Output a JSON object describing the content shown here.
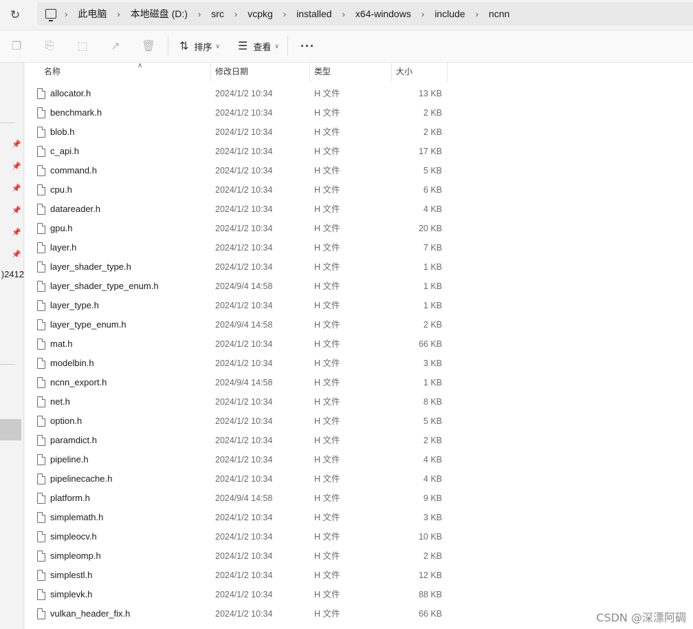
{
  "address_bar": {
    "crumbs": [
      "此电脑",
      "本地磁盘 (D:)",
      "src",
      "vcpkg",
      "installed",
      "x64-windows",
      "include",
      "ncnn"
    ]
  },
  "toolbar": {
    "sort_label": "排序",
    "view_label": "查看",
    "more_label": "···"
  },
  "nav": {
    "partial_text": "2412("
  },
  "columns": {
    "name": "名称",
    "date": "修改日期",
    "type": "类型",
    "size": "大小"
  },
  "files": [
    {
      "name": "allocator.h",
      "date": "2024/1/2 10:34",
      "type": "H 文件",
      "size": "13 KB"
    },
    {
      "name": "benchmark.h",
      "date": "2024/1/2 10:34",
      "type": "H 文件",
      "size": "2 KB"
    },
    {
      "name": "blob.h",
      "date": "2024/1/2 10:34",
      "type": "H 文件",
      "size": "2 KB"
    },
    {
      "name": "c_api.h",
      "date": "2024/1/2 10:34",
      "type": "H 文件",
      "size": "17 KB"
    },
    {
      "name": "command.h",
      "date": "2024/1/2 10:34",
      "type": "H 文件",
      "size": "5 KB"
    },
    {
      "name": "cpu.h",
      "date": "2024/1/2 10:34",
      "type": "H 文件",
      "size": "6 KB"
    },
    {
      "name": "datareader.h",
      "date": "2024/1/2 10:34",
      "type": "H 文件",
      "size": "4 KB"
    },
    {
      "name": "gpu.h",
      "date": "2024/1/2 10:34",
      "type": "H 文件",
      "size": "20 KB"
    },
    {
      "name": "layer.h",
      "date": "2024/1/2 10:34",
      "type": "H 文件",
      "size": "7 KB"
    },
    {
      "name": "layer_shader_type.h",
      "date": "2024/1/2 10:34",
      "type": "H 文件",
      "size": "1 KB"
    },
    {
      "name": "layer_shader_type_enum.h",
      "date": "2024/9/4 14:58",
      "type": "H 文件",
      "size": "1 KB"
    },
    {
      "name": "layer_type.h",
      "date": "2024/1/2 10:34",
      "type": "H 文件",
      "size": "1 KB"
    },
    {
      "name": "layer_type_enum.h",
      "date": "2024/9/4 14:58",
      "type": "H 文件",
      "size": "2 KB"
    },
    {
      "name": "mat.h",
      "date": "2024/1/2 10:34",
      "type": "H 文件",
      "size": "66 KB"
    },
    {
      "name": "modelbin.h",
      "date": "2024/1/2 10:34",
      "type": "H 文件",
      "size": "3 KB"
    },
    {
      "name": "ncnn_export.h",
      "date": "2024/9/4 14:58",
      "type": "H 文件",
      "size": "1 KB"
    },
    {
      "name": "net.h",
      "date": "2024/1/2 10:34",
      "type": "H 文件",
      "size": "8 KB"
    },
    {
      "name": "option.h",
      "date": "2024/1/2 10:34",
      "type": "H 文件",
      "size": "5 KB"
    },
    {
      "name": "paramdict.h",
      "date": "2024/1/2 10:34",
      "type": "H 文件",
      "size": "2 KB"
    },
    {
      "name": "pipeline.h",
      "date": "2024/1/2 10:34",
      "type": "H 文件",
      "size": "4 KB"
    },
    {
      "name": "pipelinecache.h",
      "date": "2024/1/2 10:34",
      "type": "H 文件",
      "size": "4 KB"
    },
    {
      "name": "platform.h",
      "date": "2024/9/4 14:58",
      "type": "H 文件",
      "size": "9 KB"
    },
    {
      "name": "simplemath.h",
      "date": "2024/1/2 10:34",
      "type": "H 文件",
      "size": "3 KB"
    },
    {
      "name": "simpleocv.h",
      "date": "2024/1/2 10:34",
      "type": "H 文件",
      "size": "10 KB"
    },
    {
      "name": "simpleomp.h",
      "date": "2024/1/2 10:34",
      "type": "H 文件",
      "size": "2 KB"
    },
    {
      "name": "simplestl.h",
      "date": "2024/1/2 10:34",
      "type": "H 文件",
      "size": "12 KB"
    },
    {
      "name": "simplevk.h",
      "date": "2024/1/2 10:34",
      "type": "H 文件",
      "size": "88 KB"
    },
    {
      "name": "vulkan_header_fix.h",
      "date": "2024/1/2 10:34",
      "type": "H 文件",
      "size": "66 KB"
    }
  ],
  "watermark": "CSDN @深漂阿碉"
}
